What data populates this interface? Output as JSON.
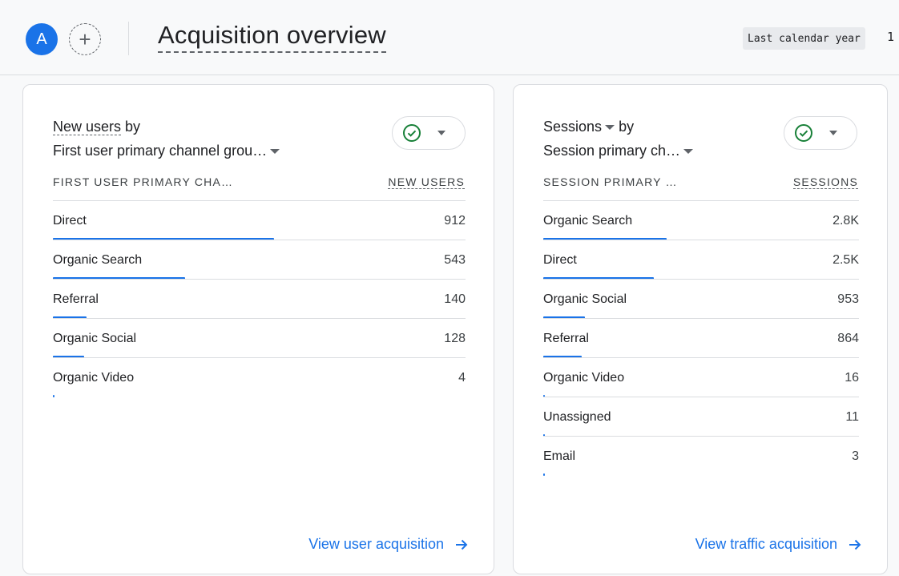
{
  "header": {
    "avatar_letter": "A",
    "add_symbol": "+",
    "title": "Acquisition overview",
    "date_range": "Last calendar year",
    "date_extra": "1"
  },
  "colors": {
    "accent": "#1a73e8",
    "check": "#188038"
  },
  "cards": [
    {
      "metric": "New users",
      "by": "by",
      "dimension": "First user primary channel grou…",
      "col_dimension": "FIRST USER PRIMARY CHA…",
      "col_metric": "NEW USERS",
      "rows": [
        {
          "label": "Direct",
          "value": "912",
          "num": 912
        },
        {
          "label": "Organic Search",
          "value": "543",
          "num": 543
        },
        {
          "label": "Referral",
          "value": "140",
          "num": 140
        },
        {
          "label": "Organic Social",
          "value": "128",
          "num": 128
        },
        {
          "label": "Organic Video",
          "value": "4",
          "num": 4
        }
      ],
      "link": "View user acquisition"
    },
    {
      "metric": "Sessions",
      "by": "by",
      "dimension": "Session primary ch…",
      "col_dimension": "SESSION PRIMARY …",
      "col_metric": "SESSIONS",
      "rows": [
        {
          "label": "Organic Search",
          "value": "2.8K",
          "num": 2800
        },
        {
          "label": "Direct",
          "value": "2.5K",
          "num": 2500
        },
        {
          "label": "Organic Social",
          "value": "953",
          "num": 953
        },
        {
          "label": "Referral",
          "value": "864",
          "num": 864
        },
        {
          "label": "Organic Video",
          "value": "16",
          "num": 16
        },
        {
          "label": "Unassigned",
          "value": "11",
          "num": 11
        },
        {
          "label": "Email",
          "value": "3",
          "num": 3
        }
      ],
      "link": "View traffic acquisition"
    }
  ]
}
